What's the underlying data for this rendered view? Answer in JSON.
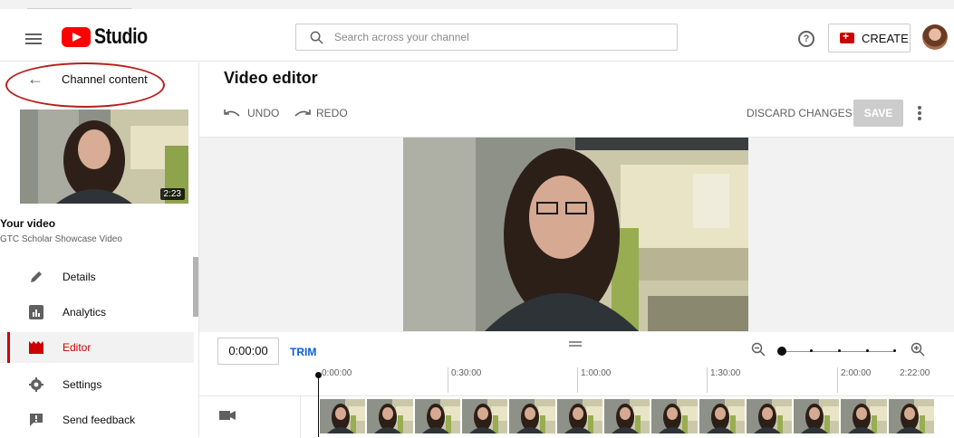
{
  "header": {
    "logo_text": "Studio",
    "search_placeholder": "Search across your channel",
    "help_glyph": "?",
    "create_label": "CREATE",
    "icons": [
      "menu-icon",
      "youtube-logo-icon",
      "search-icon",
      "help-icon",
      "create-video-icon",
      "avatar"
    ]
  },
  "sidebar": {
    "back_label": "Channel content",
    "thumbnail_duration": "2:23",
    "your_video_label": "Your video",
    "video_title": "GTC Scholar Showcase Video",
    "items": [
      {
        "label": "Details",
        "icon": "pencil-icon",
        "active": false
      },
      {
        "label": "Analytics",
        "icon": "analytics-icon",
        "active": false
      },
      {
        "label": "Editor",
        "icon": "clapperboard-icon",
        "active": true
      },
      {
        "label": "Settings",
        "icon": "gear-icon",
        "active": false
      },
      {
        "label": "Send feedback",
        "icon": "feedback-icon",
        "active": false
      }
    ]
  },
  "editor": {
    "title": "Video editor",
    "undo_label": "UNDO",
    "redo_label": "REDO",
    "discard_label": "DISCARD CHANGES",
    "save_label": "SAVE",
    "current_time": "0:00:00",
    "trim_label": "TRIM",
    "ruler_ticks": [
      "0:00:00",
      "0:30:00",
      "1:00:00",
      "1:30:00",
      "2:00:00",
      "2:22:00"
    ],
    "filmstrip_frame_count": 13
  },
  "colors": {
    "brand_red": "#ff0000",
    "active_red": "#cc0000",
    "link_blue": "#065fd4",
    "annotation_red": "#b5201c",
    "save_disabled": "#cccccc"
  }
}
